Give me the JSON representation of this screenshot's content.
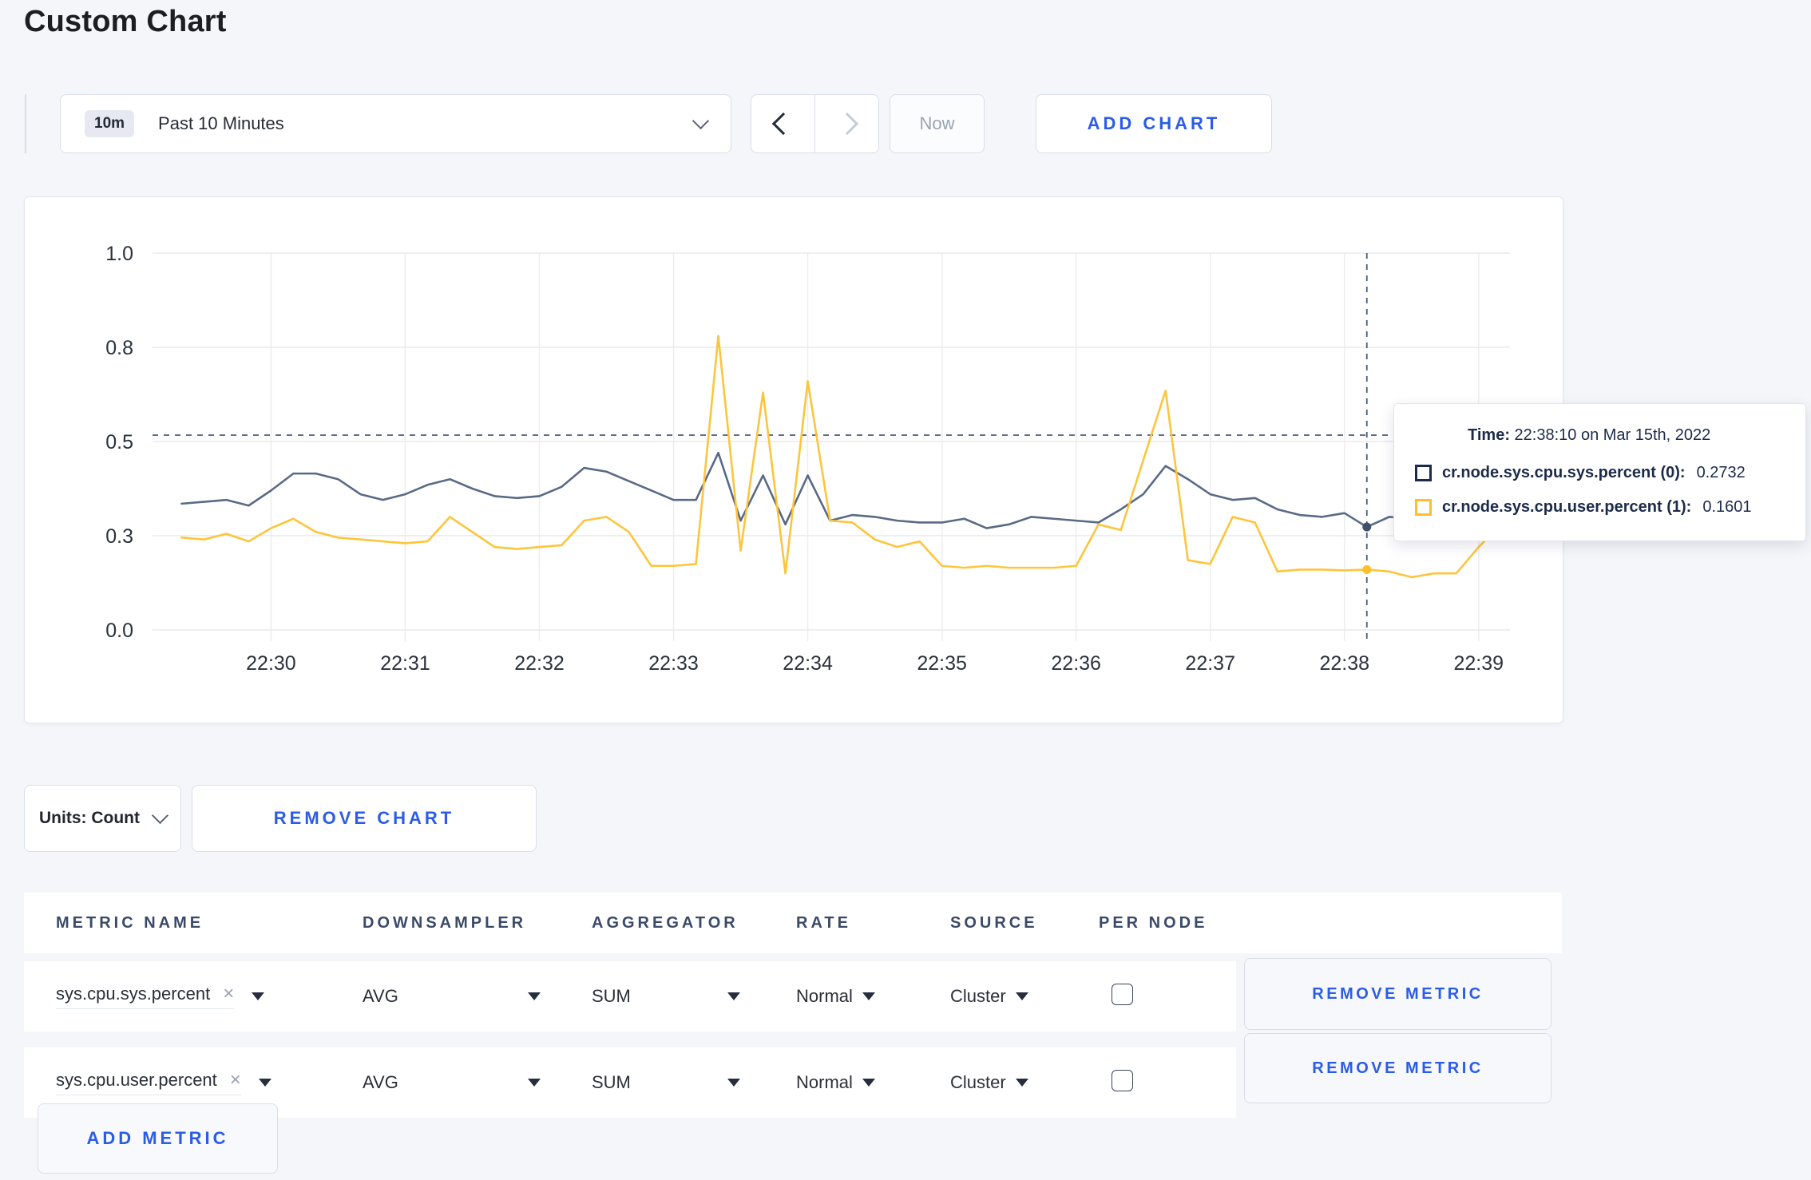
{
  "page": {
    "title": "Custom Chart"
  },
  "toolbar": {
    "time_range": {
      "badge": "10m",
      "label": "Past 10 Minutes"
    },
    "now_label": "Now",
    "add_chart_label": "ADD CHART"
  },
  "chart_controls": {
    "units_label": "Units: Count",
    "remove_chart_label": "REMOVE CHART"
  },
  "tooltip": {
    "time_label": "Time:",
    "time_value": "22:38:10 on Mar 15th, 2022",
    "rows": [
      {
        "name": "cr.node.sys.cpu.sys.percent (0):",
        "value": "0.2732"
      },
      {
        "name": "cr.node.sys.cpu.user.percent (1):",
        "value": "0.1601"
      }
    ]
  },
  "icons": {
    "clear": "×"
  },
  "metrics_table": {
    "headers": [
      "METRIC NAME",
      "DOWNSAMPLER",
      "AGGREGATOR",
      "RATE",
      "SOURCE",
      "PER NODE"
    ],
    "rows": [
      {
        "metric_name": "sys.cpu.sys.percent",
        "downsampler": "AVG",
        "aggregator": "SUM",
        "rate": "Normal",
        "source": "Cluster",
        "per_node_checked": false,
        "remove_label": "REMOVE METRIC"
      },
      {
        "metric_name": "sys.cpu.user.percent",
        "downsampler": "AVG",
        "aggregator": "SUM",
        "rate": "Normal",
        "source": "Cluster",
        "per_node_checked": false,
        "remove_label": "REMOVE METRIC"
      }
    ],
    "add_metric_label": "ADD METRIC"
  },
  "chart_data": {
    "type": "line",
    "title": "",
    "xlabel": "",
    "ylabel": "",
    "grid": true,
    "x_axis": {
      "domain_start": "22:29:07",
      "domain_end": "22:39:14",
      "ticks": [
        "22:30",
        "22:31",
        "22:32",
        "22:33",
        "22:34",
        "22:35",
        "22:36",
        "22:37",
        "22:38",
        "22:39"
      ]
    },
    "y_axis": {
      "min": 0,
      "max": 1,
      "ticks": [
        {
          "label": "0.0",
          "v": 0
        },
        {
          "label": "0.3",
          "v": 0.25
        },
        {
          "label": "0.5",
          "v": 0.5
        },
        {
          "label": "0.8",
          "v": 0.75
        },
        {
          "label": "1.0",
          "v": 1
        }
      ]
    },
    "sample_times": [
      "22:29:20",
      "22:29:30",
      "22:29:40",
      "22:29:50",
      "22:30:00",
      "22:30:10",
      "22:30:20",
      "22:30:30",
      "22:30:40",
      "22:30:50",
      "22:31:00",
      "22:31:10",
      "22:31:20",
      "22:31:30",
      "22:31:40",
      "22:31:50",
      "22:32:00",
      "22:32:10",
      "22:32:20",
      "22:32:30",
      "22:32:40",
      "22:32:50",
      "22:33:00",
      "22:33:10",
      "22:33:20",
      "22:33:30",
      "22:33:40",
      "22:33:50",
      "22:34:00",
      "22:34:10",
      "22:34:20",
      "22:34:30",
      "22:34:40",
      "22:34:50",
      "22:35:00",
      "22:35:10",
      "22:35:20",
      "22:35:30",
      "22:35:40",
      "22:35:50",
      "22:36:00",
      "22:36:10",
      "22:36:20",
      "22:36:30",
      "22:36:40",
      "22:36:50",
      "22:37:00",
      "22:37:10",
      "22:37:20",
      "22:37:30",
      "22:37:40",
      "22:37:50",
      "22:38:00",
      "22:38:10",
      "22:38:20",
      "22:38:30",
      "22:38:40",
      "22:38:50",
      "22:39:00",
      "22:39:10"
    ],
    "series": [
      {
        "name": "cr.node.sys.cpu.sys.percent (0)",
        "color": "#596a85",
        "dot_color": "#3f4f6c",
        "swatch_color": "#1c2b4a",
        "values": [
          0.335,
          0.34,
          0.345,
          0.33,
          0.37,
          0.415,
          0.415,
          0.4,
          0.36,
          0.345,
          0.36,
          0.385,
          0.4,
          0.375,
          0.355,
          0.35,
          0.355,
          0.38,
          0.43,
          0.42,
          0.395,
          0.37,
          0.345,
          0.345,
          0.47,
          0.29,
          0.41,
          0.28,
          0.41,
          0.29,
          0.305,
          0.3,
          0.29,
          0.285,
          0.285,
          0.295,
          0.27,
          0.28,
          0.3,
          0.295,
          0.29,
          0.285,
          0.32,
          0.36,
          0.435,
          0.4,
          0.36,
          0.345,
          0.35,
          0.32,
          0.305,
          0.3,
          0.31,
          0.2732,
          0.3,
          0.295,
          0.285,
          0.29,
          0.3,
          0.305
        ]
      },
      {
        "name": "cr.node.sys.cpu.user.percent (1)",
        "color": "#fdc53c",
        "dot_color": "#fdbe2c",
        "swatch_color": "#ffbe2d",
        "values": [
          0.245,
          0.24,
          0.255,
          0.235,
          0.27,
          0.295,
          0.26,
          0.245,
          0.24,
          0.235,
          0.23,
          0.235,
          0.3,
          0.26,
          0.22,
          0.215,
          0.22,
          0.225,
          0.29,
          0.3,
          0.26,
          0.17,
          0.17,
          0.175,
          0.78,
          0.21,
          0.63,
          0.15,
          0.66,
          0.29,
          0.285,
          0.24,
          0.22,
          0.235,
          0.17,
          0.165,
          0.17,
          0.165,
          0.165,
          0.165,
          0.17,
          0.28,
          0.265,
          0.45,
          0.635,
          0.185,
          0.175,
          0.3,
          0.285,
          0.155,
          0.16,
          0.16,
          0.158,
          0.1601,
          0.155,
          0.14,
          0.15,
          0.15,
          0.22,
          0.28
        ]
      }
    ],
    "crosshair": {
      "time": "22:38:10",
      "y_value": 0.517,
      "points": [
        {
          "series": 0,
          "value": 0.2732
        },
        {
          "series": 1,
          "value": 0.1601
        }
      ]
    },
    "legend_position": "tooltip"
  }
}
